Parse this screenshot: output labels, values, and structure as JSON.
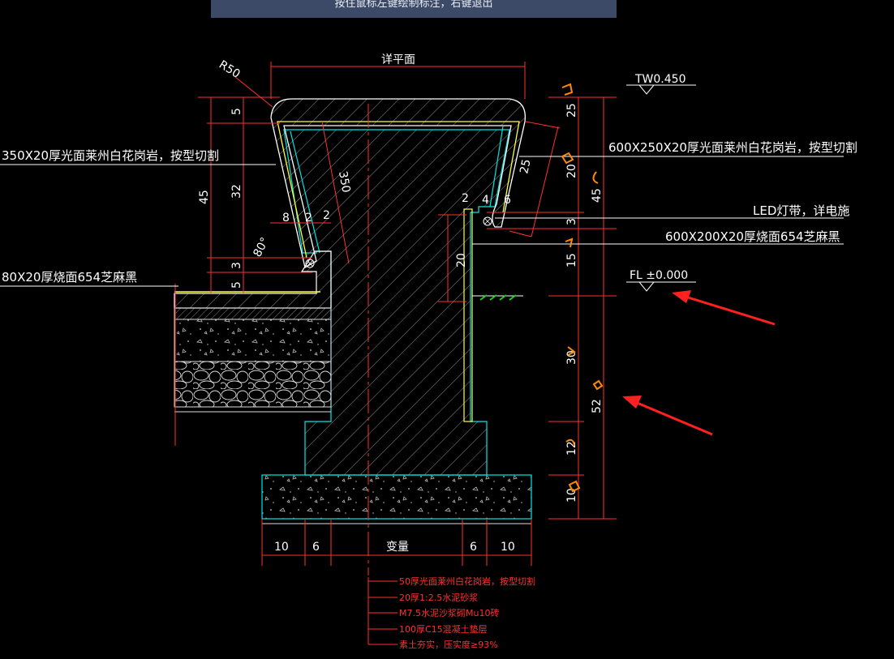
{
  "command_prompt": "按住鼠标左键绘制标注，右键退出",
  "labels": {
    "r50": "R50",
    "top_width": "详平面",
    "tw": "TW0.450",
    "fl": "FL ±0.000",
    "left_granite": "350X20厚光面莱州白花岗岩，按型切割",
    "left_paving": "80X20厚烧面654芝麻黑",
    "right_granite": "600X250X20厚光面莱州白花岗岩，按型切割",
    "led": "LED灯带，详电施",
    "right_paving": "600X200X20厚烧面654芝麻黑",
    "angle": "80°",
    "slope_len": "350"
  },
  "dims": {
    "left_total": "45",
    "left_5a": "5",
    "left_32": "32",
    "left_3": "3",
    "left_5b": "5",
    "w8": "8",
    "w2a": "2",
    "w2b": "2",
    "r2": "2",
    "r4": "4",
    "r6": "6",
    "r25": "25",
    "r20": "20",
    "right_25": "25",
    "right_20": "20",
    "right_3": "3",
    "right_15": "15",
    "right_45": "45",
    "right_30": "30",
    "right_52": "52",
    "right_12": "12",
    "right_10": "10",
    "bot_10a": "10",
    "bot_6a": "6",
    "bot_var": "变量",
    "bot_6b": "6",
    "bot_10b": "10"
  },
  "layers": [
    "50厚光面莱州白花岗岩，按型切割",
    "20厚1:2.5水泥砂浆",
    "M7.5水泥沙浆砌Mu10砖",
    "100厚C15混凝土垫层",
    "素土夯实，压实度≥93%"
  ],
  "colors": {
    "background": "#000000",
    "dimension": "#ff3030",
    "outline": "#ffffff",
    "finish": "#ffff40",
    "structure": "#00e5e5",
    "annotation_arrow": "#ff2020",
    "markup": "#ff8c00"
  }
}
